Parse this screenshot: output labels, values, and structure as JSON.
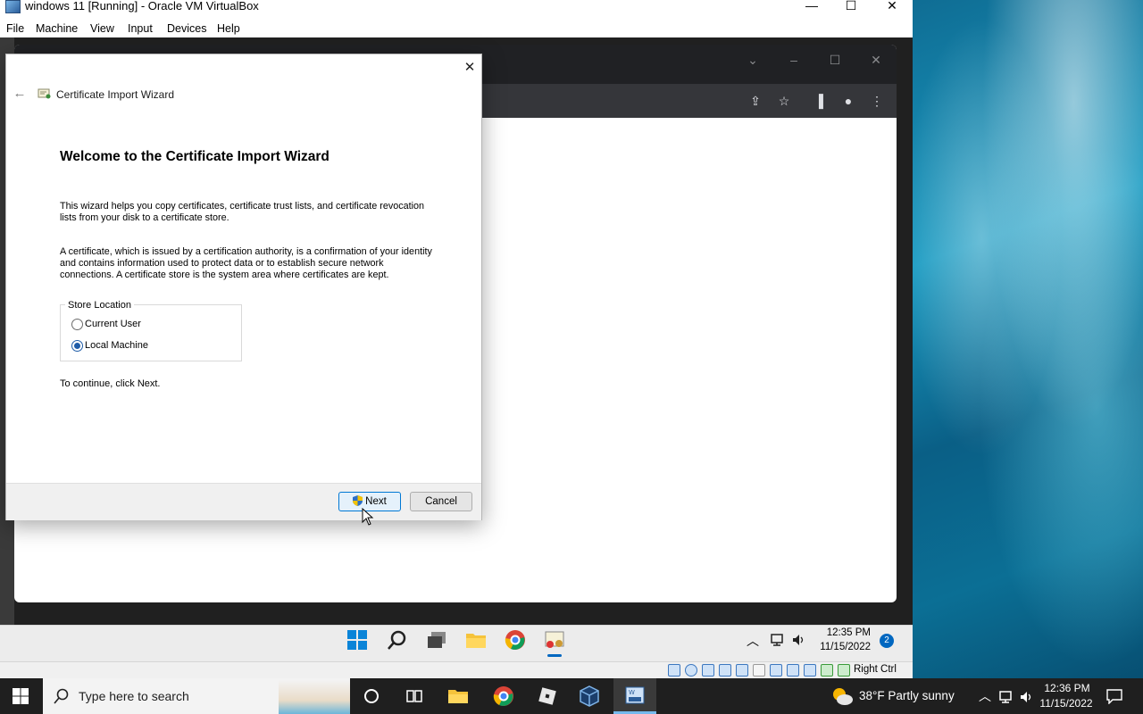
{
  "vbox": {
    "title": "windows 11 [Running] - Oracle VM VirtualBox",
    "menu": [
      "File",
      "Machine",
      "View",
      "Input",
      "Devices",
      "Help"
    ],
    "window_controls": {
      "minimize": "—",
      "maximize": "☐",
      "close": "✕"
    },
    "status_right": "Right Ctrl"
  },
  "wizard": {
    "window_title": "Certificate Import Wizard",
    "heading": "Welcome to the Certificate Import Wizard",
    "para1_line1": "This wizard helps you copy certificates, certificate trust lists, and certificate revocation",
    "para1_line2": "lists from your disk to a certificate store.",
    "para2_line1": "A certificate, which is issued by a certification authority, is a confirmation of your identity",
    "para2_line2": "and contains information used to protect data or to establish secure network",
    "para2_line3": "connections. A certificate store is the system area where certificates are kept.",
    "store_location_label": "Store Location",
    "options": [
      {
        "label": "Current User",
        "selected": false
      },
      {
        "label": "Local Machine",
        "selected": true
      }
    ],
    "continue_text": "To continue, click Next.",
    "next_label": "Next",
    "cancel_label": "Cancel",
    "close_glyph": "✕",
    "back_glyph": "←"
  },
  "guest_taskbar": {
    "time": "12:35 PM",
    "date": "11/15/2022",
    "notification_count": "2"
  },
  "host_taskbar": {
    "search_placeholder": "Type here to search",
    "weather": "38°F  Partly sunny",
    "time": "12:36 PM",
    "date": "11/15/2022"
  },
  "colors": {
    "accent": "#0078d4",
    "radio_selected": "#1f5ca8",
    "chrome_dark": "#202124"
  }
}
